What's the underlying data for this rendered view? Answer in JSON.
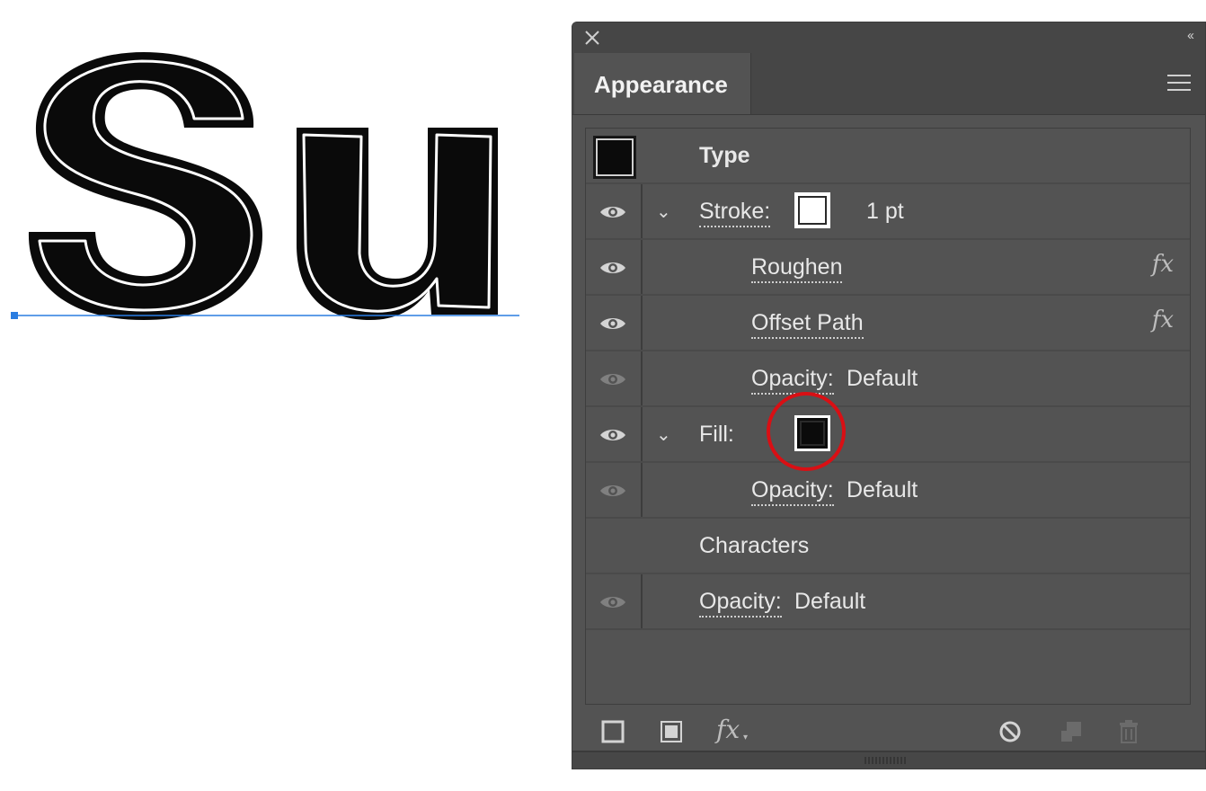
{
  "canvas": {
    "text": "Su"
  },
  "panel": {
    "tab_title": "Appearance",
    "rows": [
      {
        "label": "Type"
      },
      {
        "label": "Stroke:",
        "value": "1 pt"
      },
      {
        "label": "Roughen",
        "fx": "fx"
      },
      {
        "label": "Offset Path",
        "fx": "fx"
      },
      {
        "label": "Opacity:",
        "value": "Default"
      },
      {
        "label": "Fill:"
      },
      {
        "label": "Opacity:",
        "value": "Default"
      },
      {
        "label": "Characters"
      },
      {
        "label": "Opacity:",
        "value": "Default"
      }
    ],
    "bottom_fx": "fx"
  },
  "colors": {
    "panel_bg": "#535353",
    "highlight": "#d90f14",
    "selection_line": "#2a7de1"
  }
}
